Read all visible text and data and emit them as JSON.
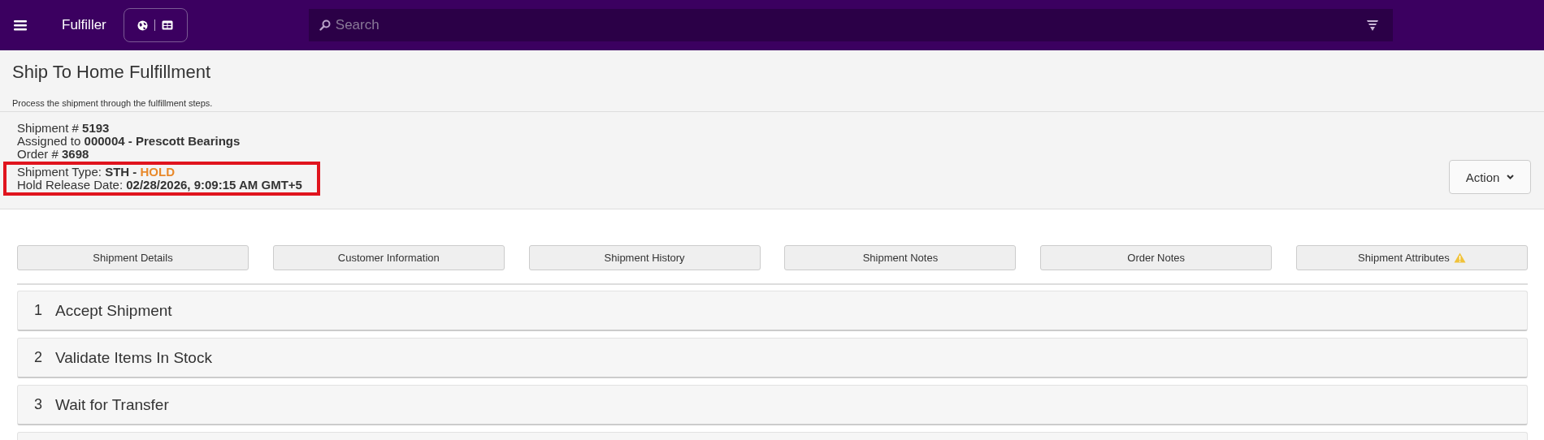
{
  "navbar": {
    "app_name": "Fulfiller",
    "search": {
      "placeholder": "Search"
    }
  },
  "page": {
    "title": "Ship To Home Fulfillment",
    "subtitle": "Process the shipment through the fulfillment steps."
  },
  "shipment_info": {
    "lines": [
      {
        "label": "Shipment #",
        "value": "5193",
        "highlighted": false
      },
      {
        "label": "Assigned to",
        "value": "000004 - Prescott Bearings",
        "highlighted": false
      },
      {
        "label": "Order #",
        "value": "3698",
        "highlighted": false
      },
      {
        "label": "Shipment Type:",
        "value": "STH -",
        "status": {
          "text": "HOLD",
          "kind": "hold"
        },
        "highlighted": true
      },
      {
        "label": "Hold Release Date:",
        "value": "02/28/2026, 9:09:15 AM GMT+5",
        "highlighted": true
      }
    ],
    "action_button": "Action"
  },
  "tabs": [
    {
      "label": "Shipment Details",
      "warning": false
    },
    {
      "label": "Customer Information",
      "warning": false
    },
    {
      "label": "Shipment History",
      "warning": false
    },
    {
      "label": "Shipment Notes",
      "warning": false
    },
    {
      "label": "Order Notes",
      "warning": false
    },
    {
      "label": "Shipment Attributes",
      "warning": true
    }
  ],
  "steps": [
    {
      "number": "1",
      "title": "Accept Shipment"
    },
    {
      "number": "2",
      "title": "Validate Items In Stock"
    },
    {
      "number": "3",
      "title": "Wait for Transfer"
    }
  ]
}
